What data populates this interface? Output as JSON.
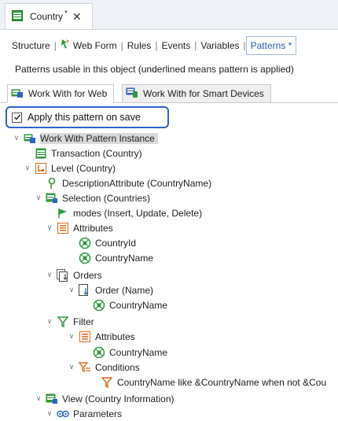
{
  "document_tab": {
    "title": "Country",
    "modified_marker": "*",
    "close": "✕"
  },
  "object_tabs": [
    {
      "label": "Structure"
    },
    {
      "label": "Web Form"
    },
    {
      "label": "Rules"
    },
    {
      "label": "Events"
    },
    {
      "label": "Variables"
    },
    {
      "label": "Patterns *"
    }
  ],
  "patterns_note": "Patterns usable in this object (underlined means pattern is applied)",
  "pattern_tabs": [
    {
      "label": "Work With for Web"
    },
    {
      "label": "Work With for Smart Devices"
    }
  ],
  "apply_checkbox": {
    "label": "Apply this pattern on save",
    "checked": true
  },
  "tree": [
    {
      "label": "Work With Pattern Instance",
      "icon": "workwith-icon"
    },
    {
      "label": "Transaction (Country)",
      "icon": "transaction-icon"
    },
    {
      "label": "Level (Country)",
      "icon": "level-icon"
    },
    {
      "label": "DescriptionAttribute (CountryName)",
      "icon": "key-icon"
    },
    {
      "label": "Selection (Countries)",
      "icon": "selection-icon"
    },
    {
      "label": "modes (Insert, Update, Delete)",
      "icon": "flag-icon"
    },
    {
      "label": "Attributes",
      "icon": "attributes-icon"
    },
    {
      "label": "CountryId",
      "icon": "attribute-icon"
    },
    {
      "label": "CountryName",
      "icon": "attribute-icon"
    },
    {
      "label": "Orders",
      "icon": "orders-icon"
    },
    {
      "label": "Order (Name)",
      "icon": "order-icon"
    },
    {
      "label": "CountryName",
      "icon": "attribute-icon"
    },
    {
      "label": "Filter",
      "icon": "filter-icon"
    },
    {
      "label": "Attributes",
      "icon": "attributes-icon"
    },
    {
      "label": "CountryName",
      "icon": "attribute-icon"
    },
    {
      "label": "Conditions",
      "icon": "conditions-icon"
    },
    {
      "label": "CountryName like &CountryName when not &Cou",
      "icon": "condition-icon"
    },
    {
      "label": "View (Country Information)",
      "icon": "view-icon"
    },
    {
      "label": "Parameters",
      "icon": "parameters-icon"
    }
  ],
  "colors": {
    "accent": "#2d64c8",
    "selection": "#d9d9d9",
    "green": "#2e9a3c",
    "orange": "#e06a1b"
  }
}
